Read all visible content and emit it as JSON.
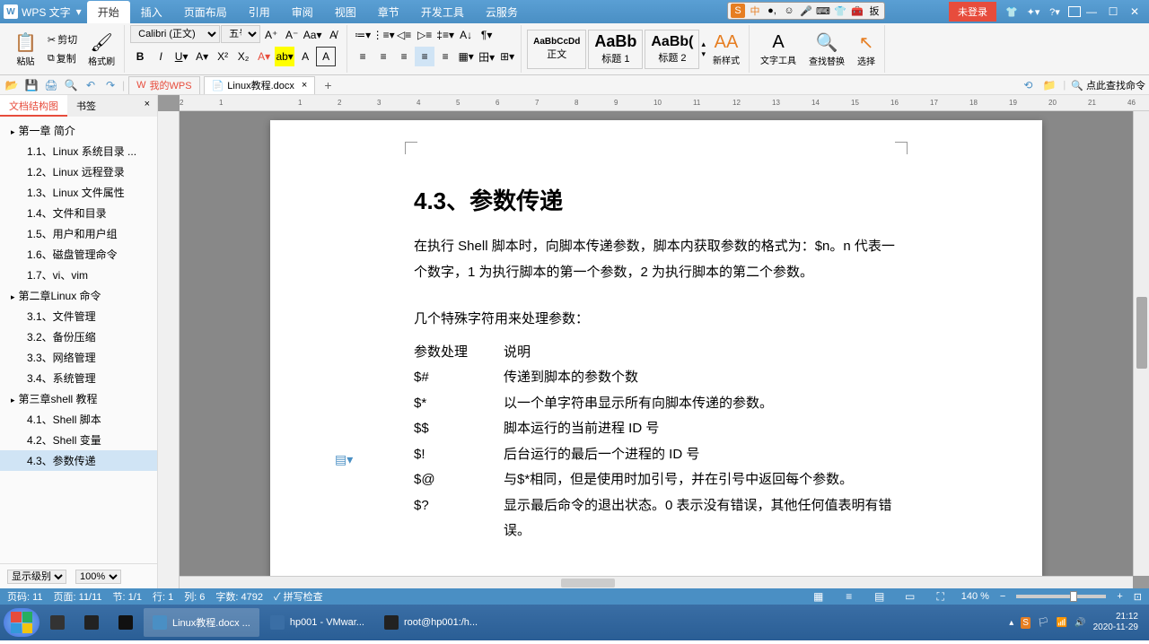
{
  "app": {
    "name": "WPS 文字",
    "login_btn": "未登录"
  },
  "menu_tabs": [
    "开始",
    "插入",
    "页面布局",
    "引用",
    "审阅",
    "视图",
    "章节",
    "开发工具",
    "云服务"
  ],
  "active_menu_tab": 0,
  "ribbon": {
    "paste": "粘贴",
    "cut": "剪切",
    "copy": "复制",
    "format_painter": "格式刷",
    "font_name": "Calibri (正文)",
    "font_size": "五号",
    "style_normal": {
      "preview": "AaBbCcDd",
      "label": "正文"
    },
    "style_h1": {
      "preview": "AaBb",
      "label": "标题 1"
    },
    "style_h2": {
      "preview": "AaBb(",
      "label": "标题 2"
    },
    "new_style": "新样式",
    "text_tool": "文字工具",
    "find_replace": "查找替换",
    "select": "选择"
  },
  "doc_tabs": {
    "wps_tab": "我的WPS",
    "file_tab": "Linux教程.docx"
  },
  "qat_right": {
    "find_cmd": "点此查找命令"
  },
  "sidebar": {
    "tab_outline": "文档结构图",
    "tab_bookmark": "书签",
    "items": [
      {
        "l": 1,
        "t": "第一章 简介"
      },
      {
        "l": 2,
        "t": "1.1、Linux 系统目录 ..."
      },
      {
        "l": 2,
        "t": "1.2、Linux 远程登录"
      },
      {
        "l": 2,
        "t": "1.3、Linux 文件属性"
      },
      {
        "l": 2,
        "t": "1.4、文件和目录"
      },
      {
        "l": 2,
        "t": "1.5、用户和用户组"
      },
      {
        "l": 2,
        "t": "1.6、磁盘管理命令"
      },
      {
        "l": 2,
        "t": "1.7、vi、vim"
      },
      {
        "l": 1,
        "t": "第二章Linux 命令"
      },
      {
        "l": 2,
        "t": "3.1、文件管理"
      },
      {
        "l": 2,
        "t": "3.2、备份压缩"
      },
      {
        "l": 2,
        "t": "3.3、网络管理"
      },
      {
        "l": 2,
        "t": "3.4、系统管理"
      },
      {
        "l": 1,
        "t": "第三章shell 教程"
      },
      {
        "l": 2,
        "t": "4.1、Shell 脚本"
      },
      {
        "l": 2,
        "t": "4.2、Shell 变量"
      },
      {
        "l": 2,
        "t": "4.3、参数传递",
        "sel": true
      }
    ],
    "footer_level": "显示级别",
    "footer_zoom": "100%"
  },
  "document": {
    "heading": "4.3、参数传递",
    "p1": "在执行 Shell 脚本时，向脚本传递参数，脚本内获取参数的格式为：$n。n 代表一个数字，1 为执行脚本的第一个参数，2 为执行脚本的第二个参数。",
    "p2": "几个特殊字符用来处理参数：",
    "th1": "参数处理",
    "th2": "说明",
    "rows": [
      {
        "a": "$#",
        "b": "传递到脚本的参数个数"
      },
      {
        "a": "$*",
        "b": "以一个单字符串显示所有向脚本传递的参数。"
      },
      {
        "a": "$$",
        "b": "脚本运行的当前进程 ID 号"
      },
      {
        "a": "$!",
        "b": "后台运行的最后一个进程的 ID 号"
      },
      {
        "a": "$@",
        "b": "与$*相同，但是使用时加引号，并在引号中返回每个参数。"
      },
      {
        "a": "$?",
        "b": "显示最后命令的退出状态。0 表示没有错误，其他任何值表明有错误。"
      }
    ]
  },
  "statusbar": {
    "page_no": "页码: 11",
    "pages": "页面: 11/11",
    "section": "节: 1/1",
    "line": "行: 1",
    "col": "列: 6",
    "words": "字数: 4792",
    "spell": "拼写检查",
    "zoom": "140 %"
  },
  "taskbar": {
    "items": [
      {
        "label": "",
        "ico": "#333"
      },
      {
        "label": "",
        "ico": "#222"
      },
      {
        "label": "",
        "ico": "#111"
      },
      {
        "label": "Linux教程.docx ...",
        "ico": "#4a8fc4",
        "active": true
      },
      {
        "label": "hp001 - VMwar...",
        "ico": "#3a6ea5"
      },
      {
        "label": "root@hp001:/h...",
        "ico": "#222"
      }
    ],
    "time": "21:12",
    "date": "2020-11-29"
  },
  "ruler_marks": [
    "2",
    "1",
    "",
    "1",
    "2",
    "3",
    "4",
    "5",
    "6",
    "7",
    "8",
    "9",
    "10",
    "11",
    "12",
    "13",
    "14",
    "15",
    "16",
    "17",
    "18",
    "19",
    "20",
    "21",
    "46"
  ]
}
